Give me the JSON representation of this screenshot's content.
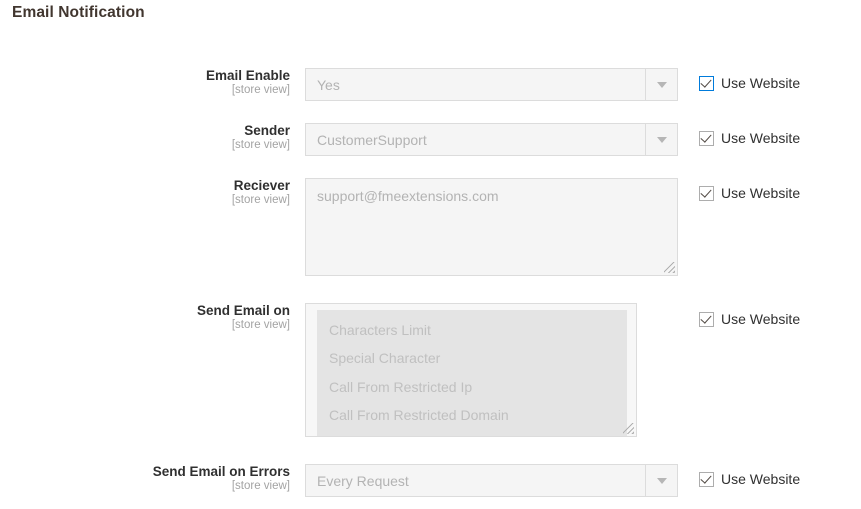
{
  "section": {
    "title": "Email Notification"
  },
  "common": {
    "scope_label": "[store view]",
    "use_website_label": "Use Website",
    "checkbox_icon": "checkmark-icon",
    "dropdown_icon": "chevron-down-icon",
    "resize_icon": "resize-grip-icon"
  },
  "fields": [
    {
      "label": "Email Enable",
      "scope": "[store view]",
      "type": "select",
      "value": "Yes",
      "use_website_label": "Use Website",
      "use_website_checked": true,
      "focused": true
    },
    {
      "label": "Sender",
      "scope": "[store view]",
      "type": "select",
      "value": "CustomerSupport",
      "use_website_label": "Use Website",
      "use_website_checked": true,
      "focused": false
    },
    {
      "label": "Reciever",
      "scope": "[store view]",
      "type": "textarea",
      "value": "support@fmeextensions.com",
      "use_website_label": "Use Website",
      "use_website_checked": true,
      "focused": false
    },
    {
      "label": "Send Email on",
      "scope": "[store view]",
      "type": "multiselect",
      "options": [
        "Characters Limit",
        "Special Character",
        "Call From Restricted Ip",
        "Call From Restricted Domain"
      ],
      "use_website_label": "Use Website",
      "use_website_checked": true,
      "focused": false
    },
    {
      "label": "Send Email on Errors",
      "scope": "[store view]",
      "type": "select",
      "value": "Every Request",
      "use_website_label": "Use Website",
      "use_website_checked": true,
      "focused": false
    }
  ],
  "colors": {
    "page_background": "#ffffff",
    "title_text": "#41362f",
    "label_text": "#303030",
    "scope_text": "#a3a3a3",
    "field_background": "#f5f5f5",
    "field_border": "#dcdcdc",
    "disabled_value_text": "#b3b3b3",
    "multiselect_inner_background": "#e4e4e4",
    "multiselect_option_text": "#c0c0c0",
    "checkbox_focus_border": "#007bdb",
    "checkbox_border": "#adadad",
    "checkmark": "#514943"
  }
}
